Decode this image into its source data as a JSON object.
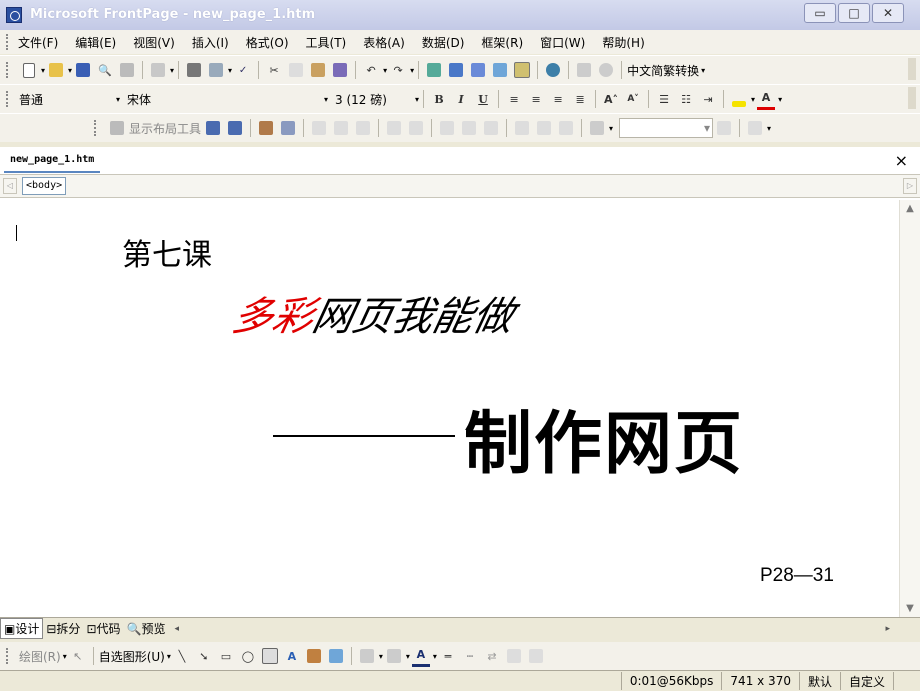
{
  "window": {
    "title": "Microsoft FrontPage - new_page_1.htm",
    "buttons": {
      "minimize": "▭",
      "maximize": "□",
      "close": "✕"
    }
  },
  "menubar": {
    "items": [
      {
        "label": "文件(F)"
      },
      {
        "label": "编辑(E)"
      },
      {
        "label": "视图(V)"
      },
      {
        "label": "插入(I)"
      },
      {
        "label": "格式(O)"
      },
      {
        "label": "工具(T)"
      },
      {
        "label": "表格(A)"
      },
      {
        "label": "数据(D)"
      },
      {
        "label": "框架(R)"
      },
      {
        "label": "窗口(W)"
      },
      {
        "label": "帮助(H)"
      }
    ]
  },
  "toolbar_standard": {
    "chinese_convert_label": "中文简繁转换"
  },
  "toolbar_format": {
    "style": "普通",
    "font": "宋体",
    "size": "3 (12 磅)",
    "bold": "B",
    "italic": "I",
    "underline": "U"
  },
  "toolbar_layout": {
    "show_layout_tools": "显示布局工具"
  },
  "editor": {
    "tab_label": "new_page_1.htm",
    "tag_selector": "<body>"
  },
  "document": {
    "lesson": "第七课",
    "subtitle_red": "多彩",
    "subtitle_rest": "网页我能做",
    "main_title": "制作网页",
    "page_ref": "P28—31",
    "colors": {
      "red": "#e00000",
      "text": "#000000"
    }
  },
  "viewbar": {
    "tabs": [
      {
        "label": "设计",
        "icon": "design-icon"
      },
      {
        "label": "拆分",
        "icon": "split-icon"
      },
      {
        "label": "代码",
        "icon": "code-icon"
      },
      {
        "label": "预览",
        "icon": "preview-icon"
      }
    ]
  },
  "drawbar": {
    "draw_label": "绘图(R)",
    "autoshapes_label": "自选图形(U)"
  },
  "statusbar": {
    "download_time": "0:01@56Kbps",
    "page_size": "741 x 370",
    "mode": "默认",
    "custom": "自定义"
  }
}
